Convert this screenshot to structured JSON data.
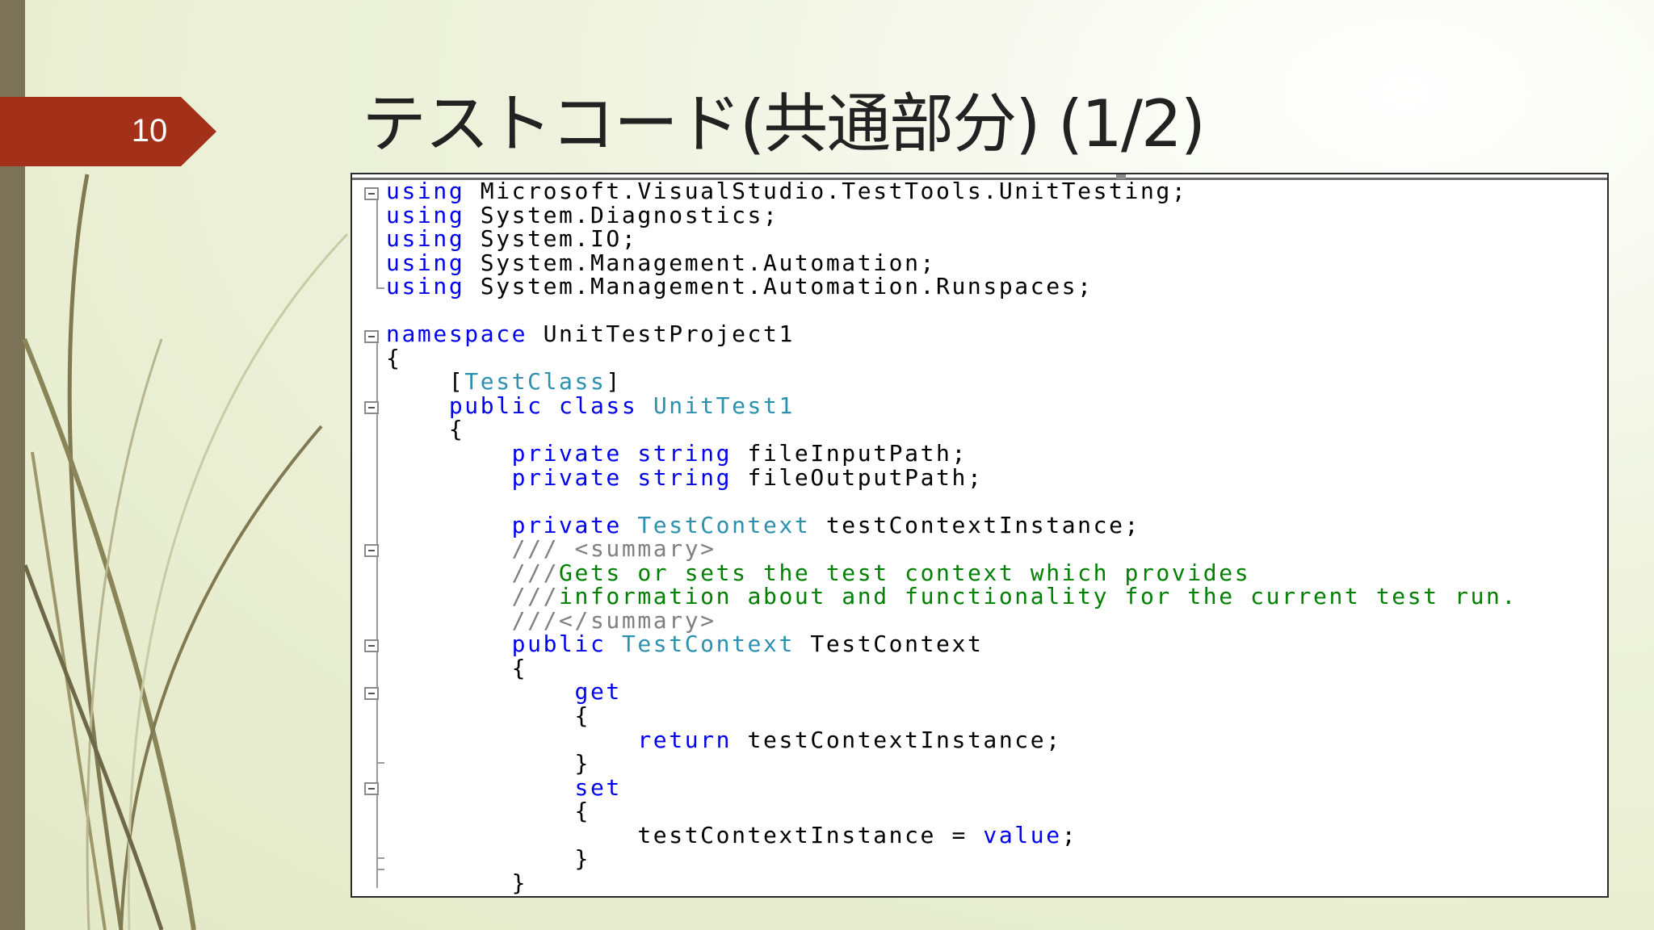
{
  "slide": {
    "number": "10",
    "title": "テストコード(共通部分) (1/2)"
  },
  "colors": {
    "tag": "#a33018",
    "left_bar": "#7c7356",
    "keyword": "#0000ee",
    "type": "#2b91af",
    "comment": "#008000",
    "xml_doc": "#808080"
  },
  "icons": {
    "fold": "collapse-minus-icon"
  },
  "code": {
    "lines": [
      [
        {
          "t": "kw",
          "s": "using"
        },
        {
          "t": "p",
          "s": " Microsoft.VisualStudio.TestTools.UnitTesting;"
        }
      ],
      [
        {
          "t": "kw",
          "s": "using"
        },
        {
          "t": "p",
          "s": " System.Diagnostics;"
        }
      ],
      [
        {
          "t": "kw",
          "s": "using"
        },
        {
          "t": "p",
          "s": " System.IO;"
        }
      ],
      [
        {
          "t": "kw",
          "s": "using"
        },
        {
          "t": "p",
          "s": " System.Management.Automation;"
        }
      ],
      [
        {
          "t": "kw",
          "s": "using"
        },
        {
          "t": "p",
          "s": " System.Management.Automation.Runspaces;"
        }
      ],
      [],
      [
        {
          "t": "kw",
          "s": "namespace"
        },
        {
          "t": "p",
          "s": " UnitTestProject1"
        }
      ],
      [
        {
          "t": "p",
          "s": "{"
        }
      ],
      [
        {
          "t": "p",
          "s": "    ["
        },
        {
          "t": "ty",
          "s": "TestClass"
        },
        {
          "t": "p",
          "s": "]"
        }
      ],
      [
        {
          "t": "p",
          "s": "    "
        },
        {
          "t": "kw",
          "s": "public class"
        },
        {
          "t": "p",
          "s": " "
        },
        {
          "t": "ty",
          "s": "UnitTest1"
        }
      ],
      [
        {
          "t": "p",
          "s": "    {"
        }
      ],
      [
        {
          "t": "p",
          "s": "        "
        },
        {
          "t": "kw",
          "s": "private string"
        },
        {
          "t": "p",
          "s": " fileInputPath;"
        }
      ],
      [
        {
          "t": "p",
          "s": "        "
        },
        {
          "t": "kw",
          "s": "private string"
        },
        {
          "t": "p",
          "s": " fileOutputPath;"
        }
      ],
      [],
      [
        {
          "t": "p",
          "s": "        "
        },
        {
          "t": "kw",
          "s": "private"
        },
        {
          "t": "p",
          "s": " "
        },
        {
          "t": "ty",
          "s": "TestContext"
        },
        {
          "t": "p",
          "s": " testContextInstance;"
        }
      ],
      [
        {
          "t": "p",
          "s": "        "
        },
        {
          "t": "xd",
          "s": "/// <summary>"
        }
      ],
      [
        {
          "t": "p",
          "s": "        "
        },
        {
          "t": "xd",
          "s": "///"
        },
        {
          "t": "cm",
          "s": "Gets or sets the test context which provides"
        }
      ],
      [
        {
          "t": "p",
          "s": "        "
        },
        {
          "t": "xd",
          "s": "///"
        },
        {
          "t": "cm",
          "s": "information about and functionality for the current test run."
        }
      ],
      [
        {
          "t": "p",
          "s": "        "
        },
        {
          "t": "xd",
          "s": "///</summary>"
        }
      ],
      [
        {
          "t": "p",
          "s": "        "
        },
        {
          "t": "kw",
          "s": "public"
        },
        {
          "t": "p",
          "s": " "
        },
        {
          "t": "ty",
          "s": "TestContext"
        },
        {
          "t": "p",
          "s": " TestContext"
        }
      ],
      [
        {
          "t": "p",
          "s": "        {"
        }
      ],
      [
        {
          "t": "p",
          "s": "            "
        },
        {
          "t": "kw",
          "s": "get"
        }
      ],
      [
        {
          "t": "p",
          "s": "            {"
        }
      ],
      [
        {
          "t": "p",
          "s": "                "
        },
        {
          "t": "kw",
          "s": "return"
        },
        {
          "t": "p",
          "s": " testContextInstance;"
        }
      ],
      [
        {
          "t": "p",
          "s": "            }"
        }
      ],
      [
        {
          "t": "p",
          "s": "            "
        },
        {
          "t": "kw",
          "s": "set"
        }
      ],
      [
        {
          "t": "p",
          "s": "            {"
        }
      ],
      [
        {
          "t": "p",
          "s": "                testContextInstance = "
        },
        {
          "t": "kw",
          "s": "value"
        },
        {
          "t": "p",
          "s": ";"
        }
      ],
      [
        {
          "t": "p",
          "s": "            }"
        }
      ],
      [
        {
          "t": "p",
          "s": "        }"
        }
      ]
    ]
  }
}
